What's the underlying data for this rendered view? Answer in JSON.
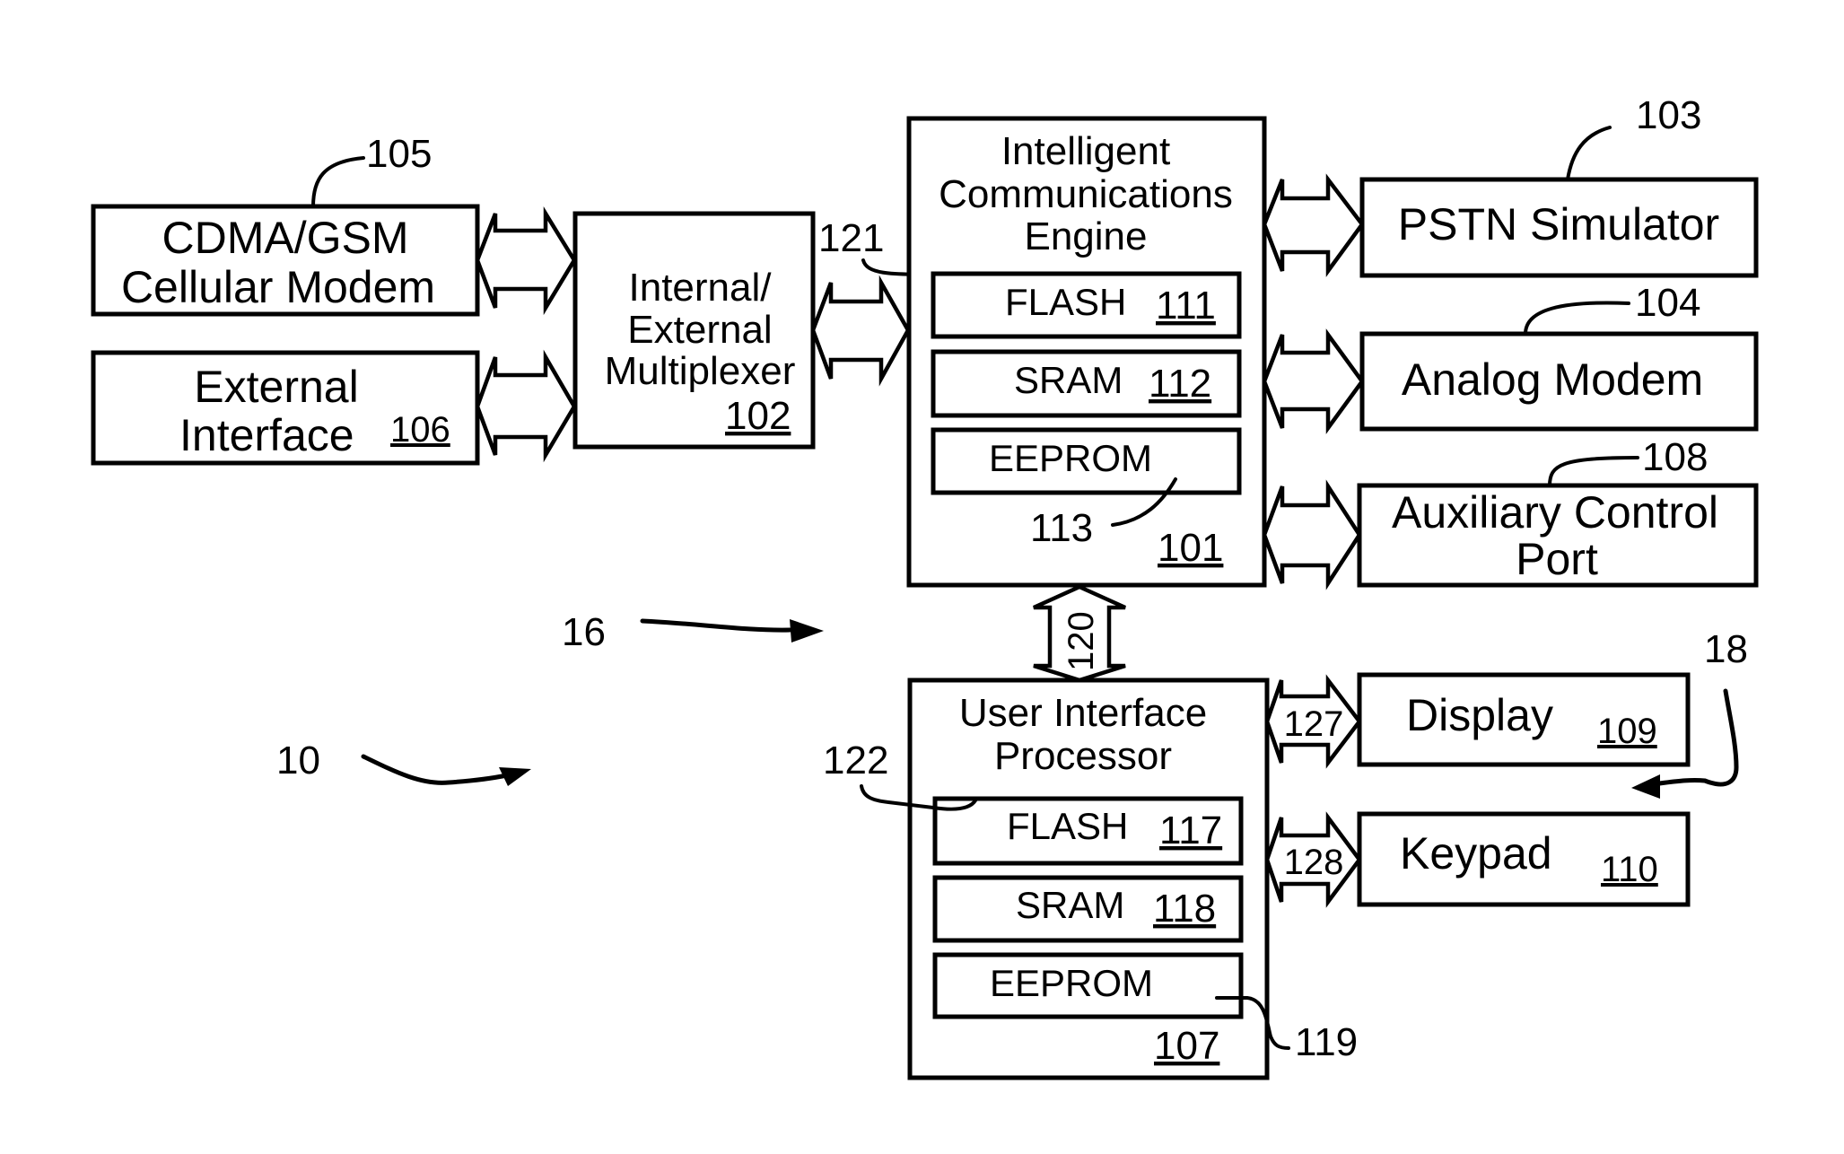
{
  "figure": {
    "system_ref": "10",
    "subsystem_ref": "16",
    "ui_group_ref": "18"
  },
  "blocks": {
    "cellular_modem": {
      "lines": [
        "CDMA/GSM",
        "Cellular Modem"
      ],
      "ref": "105"
    },
    "external_interface": {
      "lines": [
        "External",
        "Interface"
      ],
      "ref": "106"
    },
    "multiplexer": {
      "lines": [
        "Internal/",
        "External",
        "Multiplexer"
      ],
      "ref": "102"
    },
    "ice": {
      "lines": [
        "Intelligent",
        "Communications",
        "Engine"
      ],
      "ref": "101",
      "connection_ref": "121",
      "memories": [
        {
          "label": "FLASH",
          "ref": "111"
        },
        {
          "label": "SRAM",
          "ref": "112"
        },
        {
          "label": "EEPROM",
          "ref": "113"
        }
      ]
    },
    "pstn_simulator": {
      "lines": [
        "PSTN Simulator"
      ],
      "ref": "103"
    },
    "analog_modem": {
      "lines": [
        "Analog Modem"
      ],
      "ref": "104"
    },
    "aux_port": {
      "lines": [
        "Auxiliary Control",
        "Port"
      ],
      "ref": "108"
    },
    "uip": {
      "lines": [
        "User Interface",
        "Processor"
      ],
      "ref": "107",
      "connection_ref": "122",
      "memories": [
        {
          "label": "FLASH",
          "ref": "117"
        },
        {
          "label": "SRAM",
          "ref": "118"
        },
        {
          "label": "EEPROM",
          "ref": "119"
        }
      ]
    },
    "display": {
      "label": "Display",
      "ref": "109"
    },
    "keypad": {
      "label": "Keypad",
      "ref": "110"
    }
  },
  "links": {
    "ice_uip": "120",
    "uip_display": "127",
    "uip_keypad": "128"
  }
}
